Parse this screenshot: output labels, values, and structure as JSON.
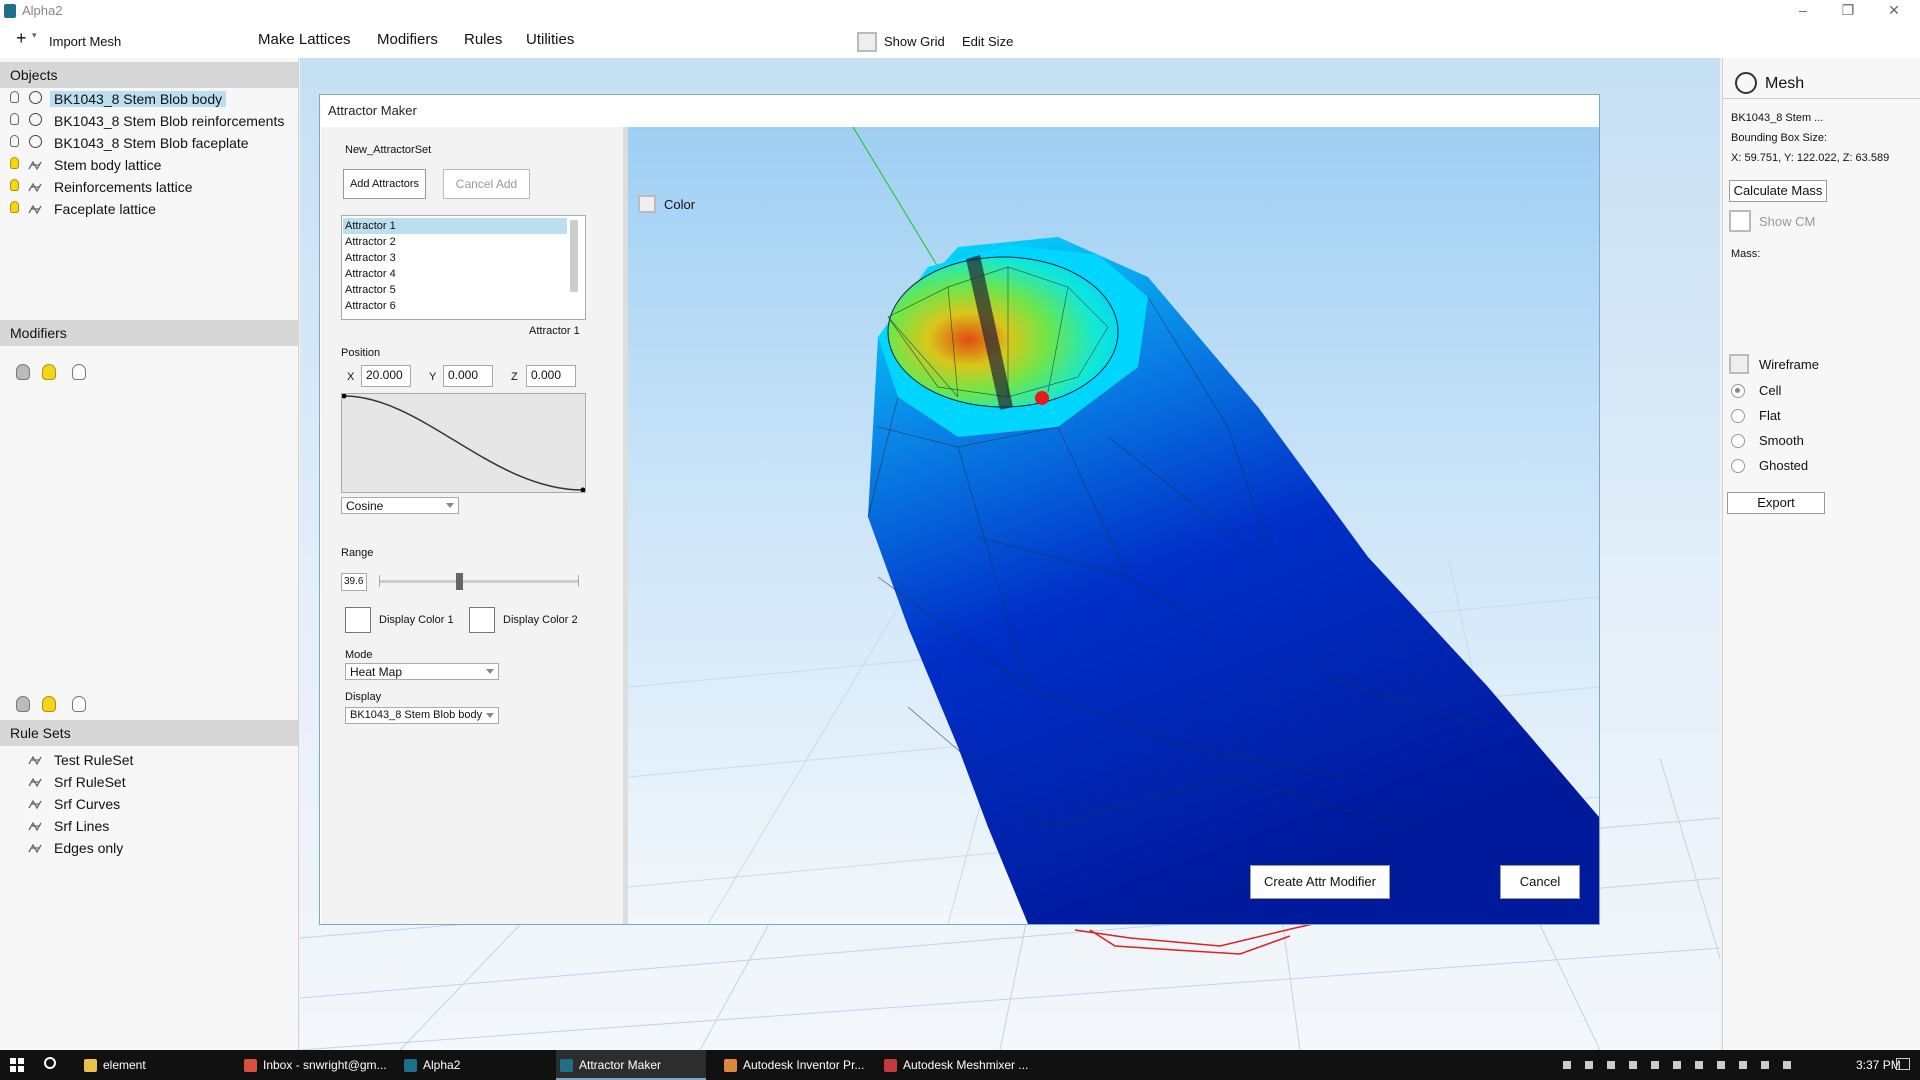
{
  "window": {
    "title": "Alpha2"
  },
  "toolbar": {
    "import_label": "Import Mesh",
    "menus": [
      "Make Lattices",
      "Modifiers",
      "Rules",
      "Utilities"
    ],
    "show_grid_label": "Show Grid",
    "edit_size_label": "Edit Size"
  },
  "left_panel": {
    "objects_header": "Objects",
    "objects": [
      {
        "label": "BK1043_8 Stem Blob body",
        "icon": "globe-icon",
        "light": "off",
        "selected": true
      },
      {
        "label": "BK1043_8 Stem Blob reinforcements",
        "icon": "globe-icon",
        "light": "off"
      },
      {
        "label": "BK1043_8 Stem Blob faceplate",
        "icon": "globe-icon",
        "light": "off"
      },
      {
        "label": "Stem body lattice",
        "icon": "lattice-icon",
        "light": "on"
      },
      {
        "label": "Reinforcements lattice",
        "icon": "lattice-icon",
        "light": "on"
      },
      {
        "label": "Faceplate lattice",
        "icon": "lattice-icon",
        "light": "on"
      }
    ],
    "modifiers_header": "Modifiers",
    "rulesets_header": "Rule Sets",
    "rulesets": [
      "Test RuleSet",
      "Srf RuleSet",
      "Srf Curves",
      "Srf Lines",
      "Edges only"
    ]
  },
  "right_panel": {
    "title": "Mesh",
    "mesh_name": "BK1043_8 Stem ...",
    "bbox_label": "Bounding Box Size:",
    "bbox_value": "X: 59.751, Y: 122.022, Z: 63.589",
    "calc_mass_label": "Calculate Mass",
    "show_cm_label": "Show CM",
    "mass_label": "Mass:",
    "wireframe_label": "Wireframe",
    "render_modes": [
      "Cell",
      "Flat",
      "Smooth",
      "Ghosted"
    ],
    "render_selected": "Cell",
    "export_label": "Export"
  },
  "dialog": {
    "title": "Attractor Maker",
    "set_name": "New_AttractorSet",
    "add_label": "Add Attractors",
    "cancel_add_label": "Cancel Add",
    "attractors": [
      "Attractor 1",
      "Attractor 2",
      "Attractor 3",
      "Attractor 4",
      "Attractor 5",
      "Attractor 6"
    ],
    "selected_attractor": "Attractor 1",
    "position_label": "Position",
    "x_label": "X",
    "x_value": "20.000",
    "y_label": "Y",
    "y_value": "0.000",
    "z_label": "Z",
    "z_value": "0.000",
    "falloff": "Cosine",
    "range_label": "Range",
    "range_value": "39.6",
    "range_fraction": 0.4,
    "display_color1_label": "Display Color 1",
    "display_color2_label": "Display Color 2",
    "mode_label": "Mode",
    "mode_value": "Heat Map",
    "display_label": "Display",
    "display_value": "BK1043_8 Stem Blob body",
    "color_label": "Color",
    "create_label": "Create Attr Modifier",
    "cancel_label": "Cancel"
  },
  "taskbar": {
    "tasks": [
      {
        "label": "element",
        "color": "#e8c04a"
      },
      {
        "label": "Inbox - snwright@gm...",
        "color": "#d9503f"
      },
      {
        "label": "Alpha2",
        "color": "#1f6f8a"
      },
      {
        "label": "Attractor Maker",
        "color": "#1f6f8a"
      },
      {
        "label": "Autodesk Inventor Pr...",
        "color": "#e0883a"
      },
      {
        "label": "Autodesk Meshmixer ...",
        "color": "#c33b3b"
      }
    ],
    "active": "Attractor Maker",
    "clock": "3:37 PM"
  }
}
